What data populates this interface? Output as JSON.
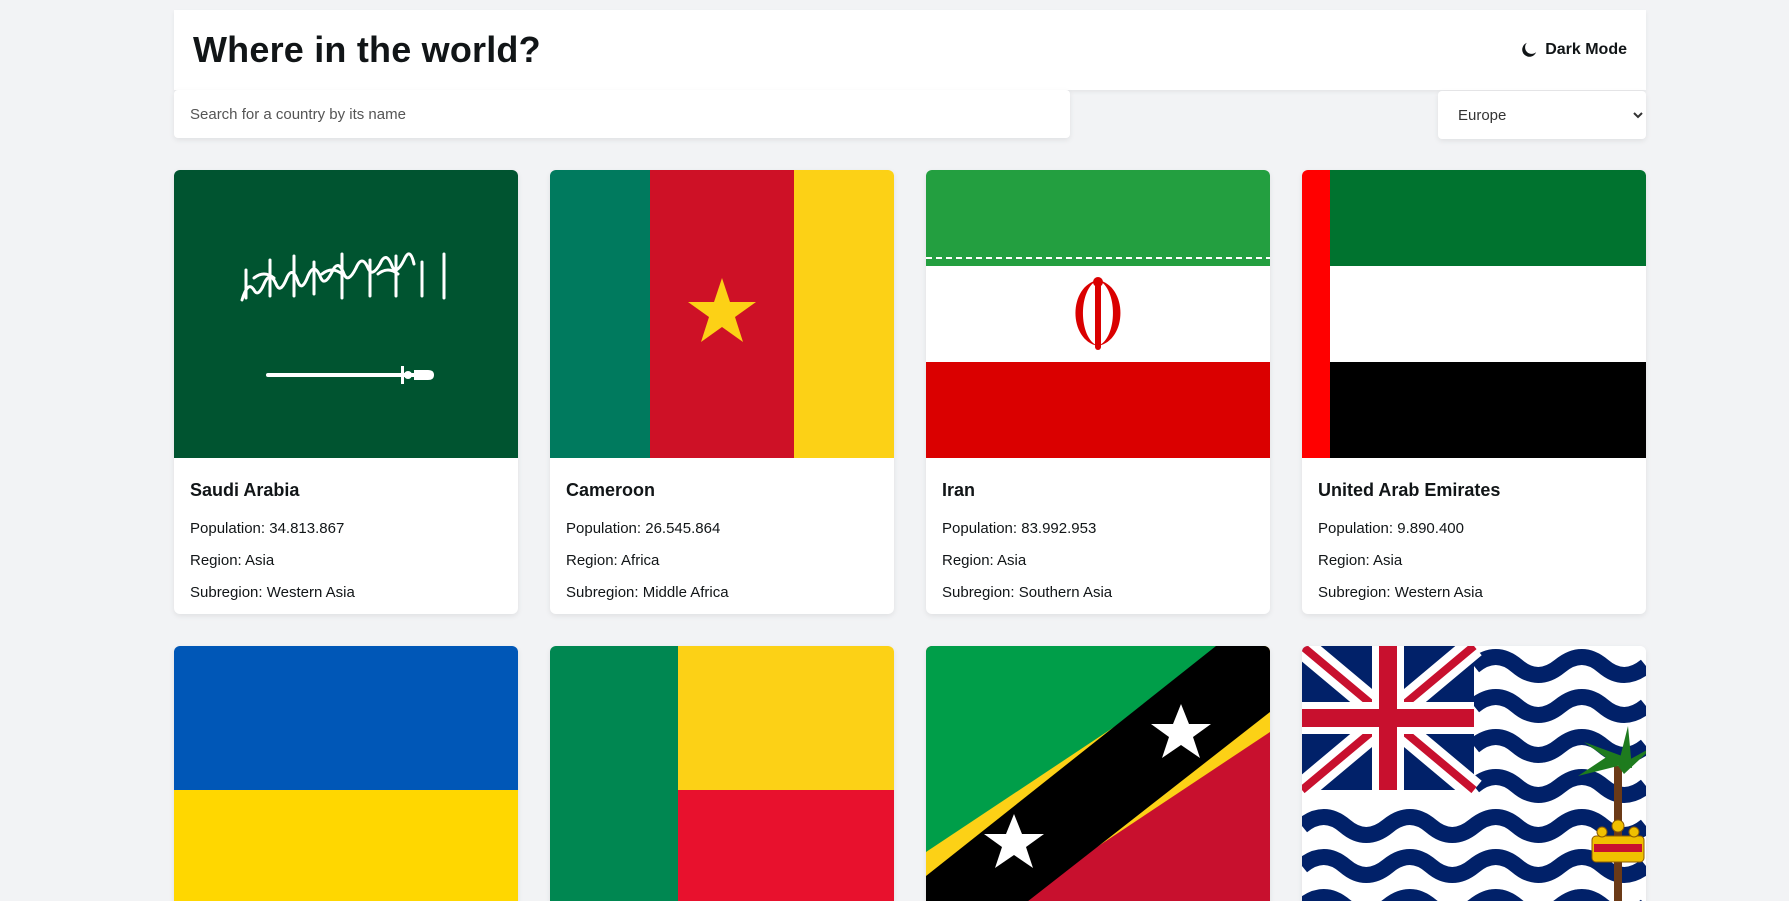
{
  "header": {
    "title": "Where in the world?",
    "dark_mode_label": "Dark Mode",
    "moon_icon": "moon-icon"
  },
  "search": {
    "placeholder": "Search for a country by its name",
    "value": ""
  },
  "filter": {
    "selected": "Europe"
  },
  "labels": {
    "population": "Population: ",
    "region": "Region: ",
    "subregion": "Subregion: "
  },
  "countries": [
    {
      "name": "Saudi Arabia",
      "population": "34.813.867",
      "region": "Asia",
      "subregion": "Western Asia"
    },
    {
      "name": "Cameroon",
      "population": "26.545.864",
      "region": "Africa",
      "subregion": "Middle Africa"
    },
    {
      "name": "Iran",
      "population": "83.992.953",
      "region": "Asia",
      "subregion": "Southern Asia"
    },
    {
      "name": "United Arab Emirates",
      "population": "9.890.400",
      "region": "Asia",
      "subregion": "Western Asia"
    }
  ],
  "colors": {
    "background": "#f2f3f5",
    "card": "#ffffff",
    "text": "#111517"
  }
}
